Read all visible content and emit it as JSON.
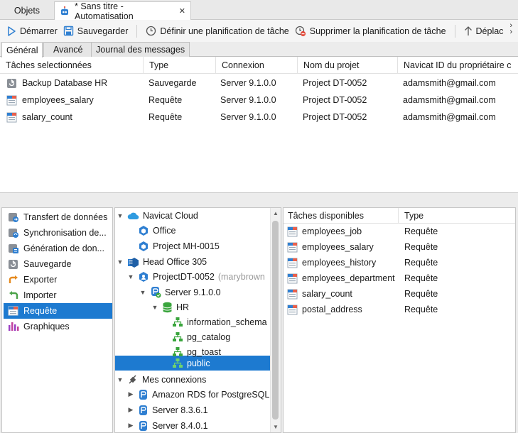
{
  "tabs": {
    "objects_label": "Objets",
    "automation_label": "* Sans titre - Automatisation"
  },
  "toolbar": {
    "start": "Démarrer",
    "save": "Sauvegarder",
    "schedule": "Définir une planification de tâche",
    "delete_schedule": "Supprimer la planification de tâche",
    "move": "Déplac"
  },
  "subtabs": [
    "Général",
    "Avancé",
    "Journal des messages"
  ],
  "tasks_table": {
    "headers": [
      "Tâches selectionnées",
      "Type",
      "Connexion",
      "Nom du projet",
      "Navicat ID du propriétaire c"
    ],
    "rows": [
      {
        "name": "Backup Database HR",
        "type": "Sauvegarde",
        "connection": "Server 9.1.0.0",
        "project": "Project DT-0052",
        "owner": "adamsmith@gmail.com",
        "icon": "backup-icon"
      },
      {
        "name": "employees_salary",
        "type": "Requête",
        "connection": "Server 9.1.0.0",
        "project": "Project DT-0052",
        "owner": "adamsmith@gmail.com",
        "icon": "query-icon"
      },
      {
        "name": "salary_count",
        "type": "Requête",
        "connection": "Server 9.1.0.0",
        "project": "Project DT-0052",
        "owner": "adamsmith@gmail.com",
        "icon": "query-icon"
      }
    ]
  },
  "sidebar": {
    "items": [
      {
        "label": "Transfert de données",
        "icon": "data-transfer-icon"
      },
      {
        "label": "Synchronisation de...",
        "icon": "sync-icon"
      },
      {
        "label": "Génération de don...",
        "icon": "data-generation-icon"
      },
      {
        "label": "Sauvegarde",
        "icon": "backup-icon"
      },
      {
        "label": "Exporter",
        "icon": "export-icon"
      },
      {
        "label": "Importer",
        "icon": "import-icon"
      },
      {
        "label": "Requête",
        "icon": "query-icon"
      },
      {
        "label": "Graphiques",
        "icon": "charts-icon"
      }
    ],
    "selected_index": 6
  },
  "tree": {
    "navicat_cloud": "Navicat Cloud",
    "office": "Office",
    "project_mh": "Project MH-0015",
    "head_office": "Head Office 305",
    "project_dt": "ProjectDT-0052",
    "project_dt_owner": "(marybrown",
    "server_910": "Server 9.1.0.0",
    "hr": "HR",
    "schemas": [
      "information_schema",
      "pg_catalog",
      "pg_toast",
      "public"
    ],
    "selected_schema": "public",
    "my_connections": "Mes connexions",
    "connections": [
      "Amazon RDS for PostgreSQL",
      "Server 8.3.6.1",
      "Server 8.4.0.1"
    ]
  },
  "available_tasks": {
    "headers": [
      "Tâches disponibles",
      "Type"
    ],
    "rows": [
      {
        "name": "employees_job",
        "type": "Requête"
      },
      {
        "name": "employees_salary",
        "type": "Requête"
      },
      {
        "name": "employees_history",
        "type": "Requête"
      },
      {
        "name": "employees_department",
        "type": "Requête"
      },
      {
        "name": "salary_count",
        "type": "Requête"
      },
      {
        "name": "postal_address",
        "type": "Requête"
      }
    ]
  },
  "colors": {
    "selection": "#1d7ad0",
    "accent_blue": "#2f7fd1"
  }
}
